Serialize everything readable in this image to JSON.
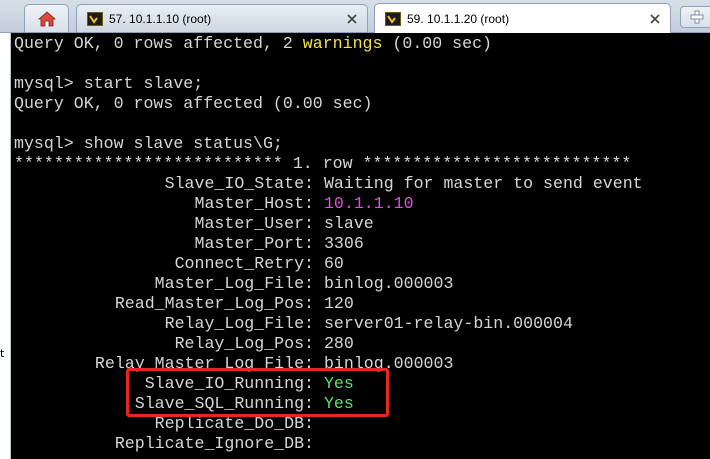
{
  "tabs": [
    {
      "label": "57. 10.1.1.10 (root)",
      "active": false
    },
    {
      "label": "59. 10.1.1.20 (root)",
      "active": true
    }
  ],
  "icons": {
    "home": "home-icon",
    "terminal": "terminal-tab-icon",
    "close": "close-icon",
    "new_tab": "new-tab-icon"
  },
  "left_strip_text": "t",
  "terminal": {
    "line1_prefix": "Query OK, 0 rows affected, 2 ",
    "line1_warn": "warnings",
    "line1_suffix": " (0.00 sec)",
    "cmd_start_slave": "mysql> start slave;",
    "query_ok": "Query OK, 0 rows affected (0.00 sec)",
    "cmd_show_status": "mysql> show slave status\\G;",
    "row_banner": "*************************** 1. row ***************************",
    "fields": [
      {
        "key": "Slave_IO_State:",
        "value": "Waiting for master to send event",
        "color": "default"
      },
      {
        "key": "Master_Host:",
        "value": "10.1.1.10",
        "color": "magenta"
      },
      {
        "key": "Master_User:",
        "value": "slave",
        "color": "default"
      },
      {
        "key": "Master_Port:",
        "value": "3306",
        "color": "default"
      },
      {
        "key": "Connect_Retry:",
        "value": "60",
        "color": "default"
      },
      {
        "key": "Master_Log_File:",
        "value": "binlog.000003",
        "color": "default"
      },
      {
        "key": "Read_Master_Log_Pos:",
        "value": "120",
        "color": "default"
      },
      {
        "key": "Relay_Log_File:",
        "value": "server01-relay-bin.000004",
        "color": "default"
      },
      {
        "key": "Relay_Log_Pos:",
        "value": "280",
        "color": "default"
      },
      {
        "key": "Relay_Master_Log_File:",
        "value": "binlog.000003",
        "color": "default"
      },
      {
        "key": "Slave_IO_Running:",
        "value": "Yes",
        "color": "green"
      },
      {
        "key": "Slave_SQL_Running:",
        "value": "Yes",
        "color": "green"
      },
      {
        "key": "Replicate_Do_DB:",
        "value": "",
        "color": "default"
      },
      {
        "key": "Replicate_Ignore_DB:",
        "value": "",
        "color": "default"
      }
    ]
  },
  "colors": {
    "terminal_bg": "#000000",
    "terminal_fg": "#d6d6d6",
    "warning": "#f2e24a",
    "host": "#e14ddf",
    "running_yes": "#59e36a",
    "highlight_border": "#e8261e"
  }
}
